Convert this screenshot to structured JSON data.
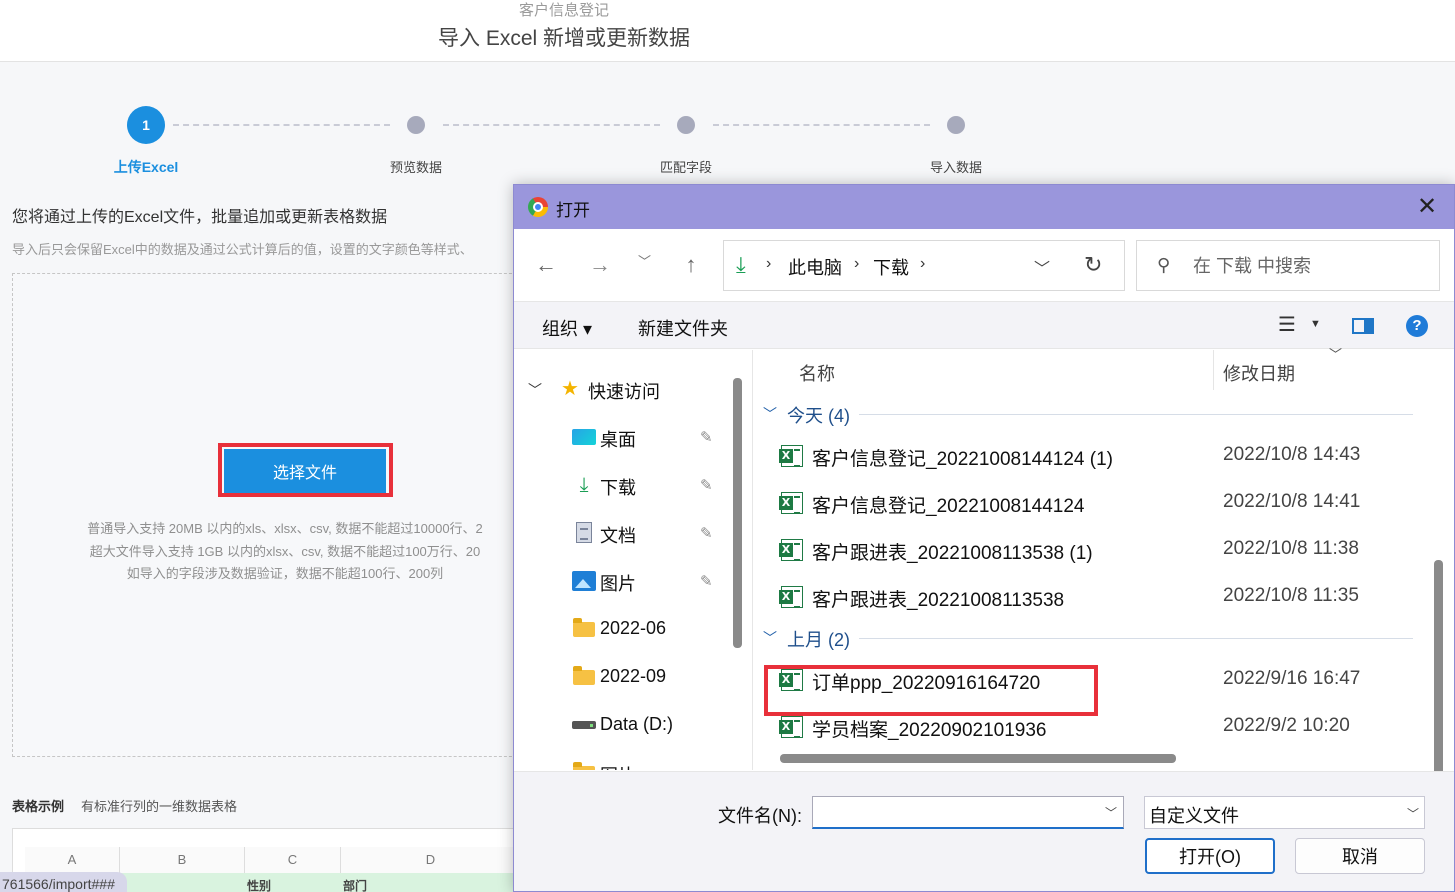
{
  "app": {
    "subtitle": "客户信息登记",
    "title": "导入 Excel 新增或更新数据"
  },
  "steps": [
    {
      "number": "1",
      "label": "上传Excel",
      "active": true
    },
    {
      "number": "",
      "label": "预览数据",
      "active": false
    },
    {
      "number": "",
      "label": "匹配字段",
      "active": false
    },
    {
      "number": "",
      "label": "导入数据",
      "active": false
    }
  ],
  "upload": {
    "intro": "您将通过上传的Excel文件，批量追加或更新表格数据",
    "intro_sub": "导入后只会保留Excel中的数据及通过公式计算后的值，设置的文字颜色等样式、",
    "choose_button": "选择文件",
    "hint_1": "普通导入支持 20MB 以内的xls、xlsx、csv, 数据不能超过10000行、2",
    "hint_2": "超大文件导入支持 1GB 以内的xlsx、csv, 数据不能超过100万行、20",
    "hint_3": "如导入的字段涉及数据验证，数据不能超100行、200列"
  },
  "sample": {
    "title": "表格示例",
    "desc": "有标准行列的一维数据表格",
    "columns": [
      "A",
      "B",
      "C",
      "D"
    ],
    "row_cells": [
      "性别",
      "部门"
    ]
  },
  "url_fragment": "761566/import###",
  "dialog": {
    "title": "打开",
    "close": "✕",
    "address": {
      "crumbs": [
        "此电脑",
        "下载"
      ]
    },
    "search_placeholder": "在 下载 中搜索",
    "toolbar": {
      "organize": "组织 ▾",
      "new_folder": "新建文件夹",
      "help": "?"
    },
    "sidebar": {
      "quick_access": "快速访问",
      "items": [
        {
          "label": "桌面",
          "icon": "desktop-icon",
          "pinned": true
        },
        {
          "label": "下载",
          "icon": "download-icon",
          "pinned": true
        },
        {
          "label": "文档",
          "icon": "document-icon",
          "pinned": true
        },
        {
          "label": "图片",
          "icon": "picture-icon",
          "pinned": true
        },
        {
          "label": "2022-06",
          "icon": "folder-icon",
          "pinned": false
        },
        {
          "label": "2022-09",
          "icon": "folder-icon",
          "pinned": false
        },
        {
          "label": "Data (D:)",
          "icon": "drive-icon",
          "pinned": false
        },
        {
          "label": "图片",
          "icon": "folder-icon",
          "pinned": false
        }
      ]
    },
    "columns": {
      "name": "名称",
      "date": "修改日期"
    },
    "groups": [
      {
        "label": "今天 (4)",
        "files": [
          {
            "name": "客户信息登记_20221008144124 (1)",
            "date": "2022/10/8 14:43"
          },
          {
            "name": "客户信息登记_20221008144124",
            "date": "2022/10/8 14:41",
            "highlighted": true
          },
          {
            "name": "客户跟进表_20221008113538 (1)",
            "date": "2022/10/8 11:38"
          },
          {
            "name": "客户跟进表_20221008113538",
            "date": "2022/10/8 11:35"
          }
        ]
      },
      {
        "label": "上月 (2)",
        "files": [
          {
            "name": "订单ppp_20220916164720",
            "date": "2022/9/16 16:47"
          },
          {
            "name": "学员档案_20220902101936",
            "date": "2022/9/2 10:20"
          }
        ]
      }
    ],
    "filename_label": "文件名(N):",
    "filename_value": "",
    "filetype": "自定义文件",
    "open_button": "打开(O)",
    "cancel_button": "取消"
  },
  "colors": {
    "accent": "#1b8fdf",
    "highlight_red": "#e8303a",
    "dialog_titlebar": "#9a96dc",
    "excel_green": "#1d7a43"
  }
}
